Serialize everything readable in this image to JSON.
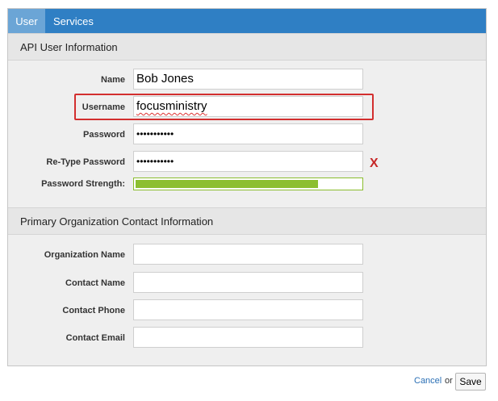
{
  "tabs": [
    {
      "label": "User",
      "active": true
    },
    {
      "label": "Services",
      "active": false
    }
  ],
  "api_user": {
    "title": "API User Information",
    "name_label": "Name",
    "name_value": "Bob Jones",
    "username_label": "Username",
    "username_value": "focusministry",
    "password_label": "Password",
    "password_value": "•••••••••••",
    "retype_label": "Re-Type Password",
    "retype_value": "•••••••••••",
    "retype_error": "X",
    "strength_label": "Password Strength:",
    "strength_percent": 81
  },
  "org_contact": {
    "title": "Primary Organization Contact Information",
    "org_name_label": "Organization Name",
    "contact_name_label": "Contact Name",
    "contact_phone_label": "Contact Phone",
    "contact_email_label": "Contact Email"
  },
  "footer": {
    "cancel_label": "Cancel",
    "or_label": "or",
    "save_label": "Save"
  },
  "colors": {
    "tab_bar": "#2f7fc4",
    "tab_active": "#6ba5d6",
    "highlight": "#d32f2f",
    "strength": "#8cbf30",
    "link": "#2a6fb5"
  }
}
